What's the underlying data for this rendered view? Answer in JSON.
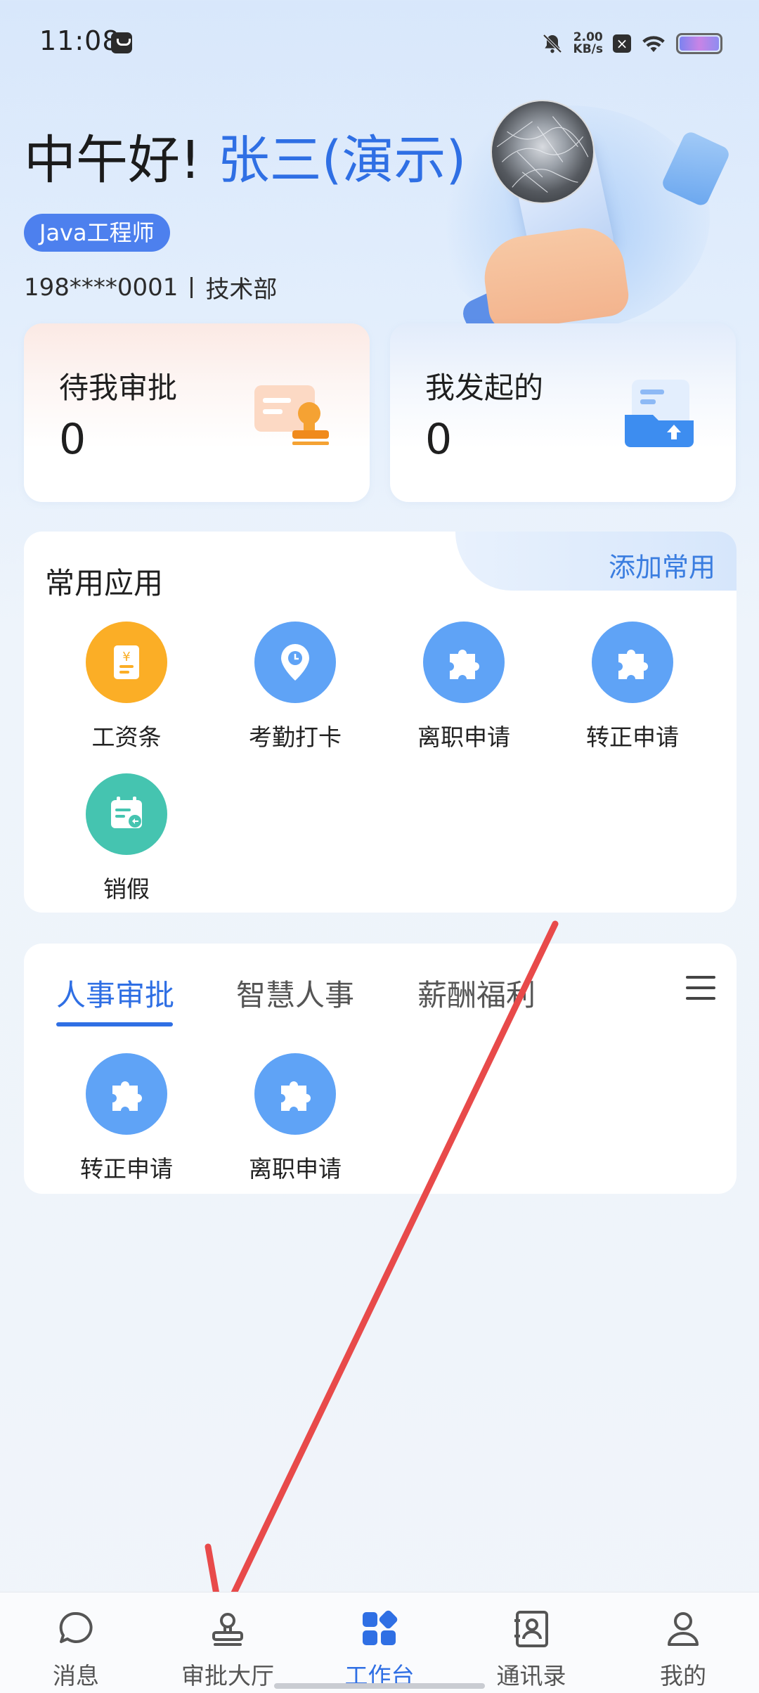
{
  "status_bar": {
    "time": "11:08",
    "net_speed_value": "2.00",
    "net_speed_unit": "KB/s",
    "icons": [
      "notification-icon",
      "mute-icon",
      "close-box-icon",
      "wifi-icon",
      "battery-icon"
    ]
  },
  "header": {
    "greeting": "中午好!",
    "name": "张三(演示)",
    "role": "Java工程师",
    "phone": "198****0001",
    "department": "技术部"
  },
  "stats": {
    "pending": {
      "label": "待我审批",
      "value": "0"
    },
    "initiated": {
      "label": "我发起的",
      "value": "0"
    }
  },
  "common_apps": {
    "title": "常用应用",
    "add_label": "添加常用",
    "items": [
      {
        "label": "工资条",
        "icon": "payslip-icon",
        "color": "#fbae26"
      },
      {
        "label": "考勤打卡",
        "icon": "location-clock-icon",
        "color": "#5fa3f6"
      },
      {
        "label": "离职申请",
        "icon": "puzzle-icon",
        "color": "#5fa3f6"
      },
      {
        "label": "转正申请",
        "icon": "puzzle-icon",
        "color": "#5fa3f6"
      },
      {
        "label": "销假",
        "icon": "calendar-return-icon",
        "color": "#45c4b0"
      }
    ]
  },
  "hr_section": {
    "tabs": [
      "人事审批",
      "智慧人事",
      "薪酬福利"
    ],
    "active_tab": "人事审批",
    "items": [
      {
        "label": "转正申请",
        "icon": "puzzle-icon"
      },
      {
        "label": "离职申请",
        "icon": "puzzle-icon"
      }
    ]
  },
  "bottom_nav": {
    "items": [
      {
        "label": "消息",
        "icon": "chat-bubble-icon"
      },
      {
        "label": "审批大厅",
        "icon": "stamp-icon"
      },
      {
        "label": "工作台",
        "icon": "grid-apps-icon"
      },
      {
        "label": "通讯录",
        "icon": "contacts-icon"
      },
      {
        "label": "我的",
        "icon": "person-icon"
      }
    ],
    "active": "工作台"
  },
  "colors": {
    "accent": "#2f6fe4",
    "arrow": "#e84a4a"
  }
}
